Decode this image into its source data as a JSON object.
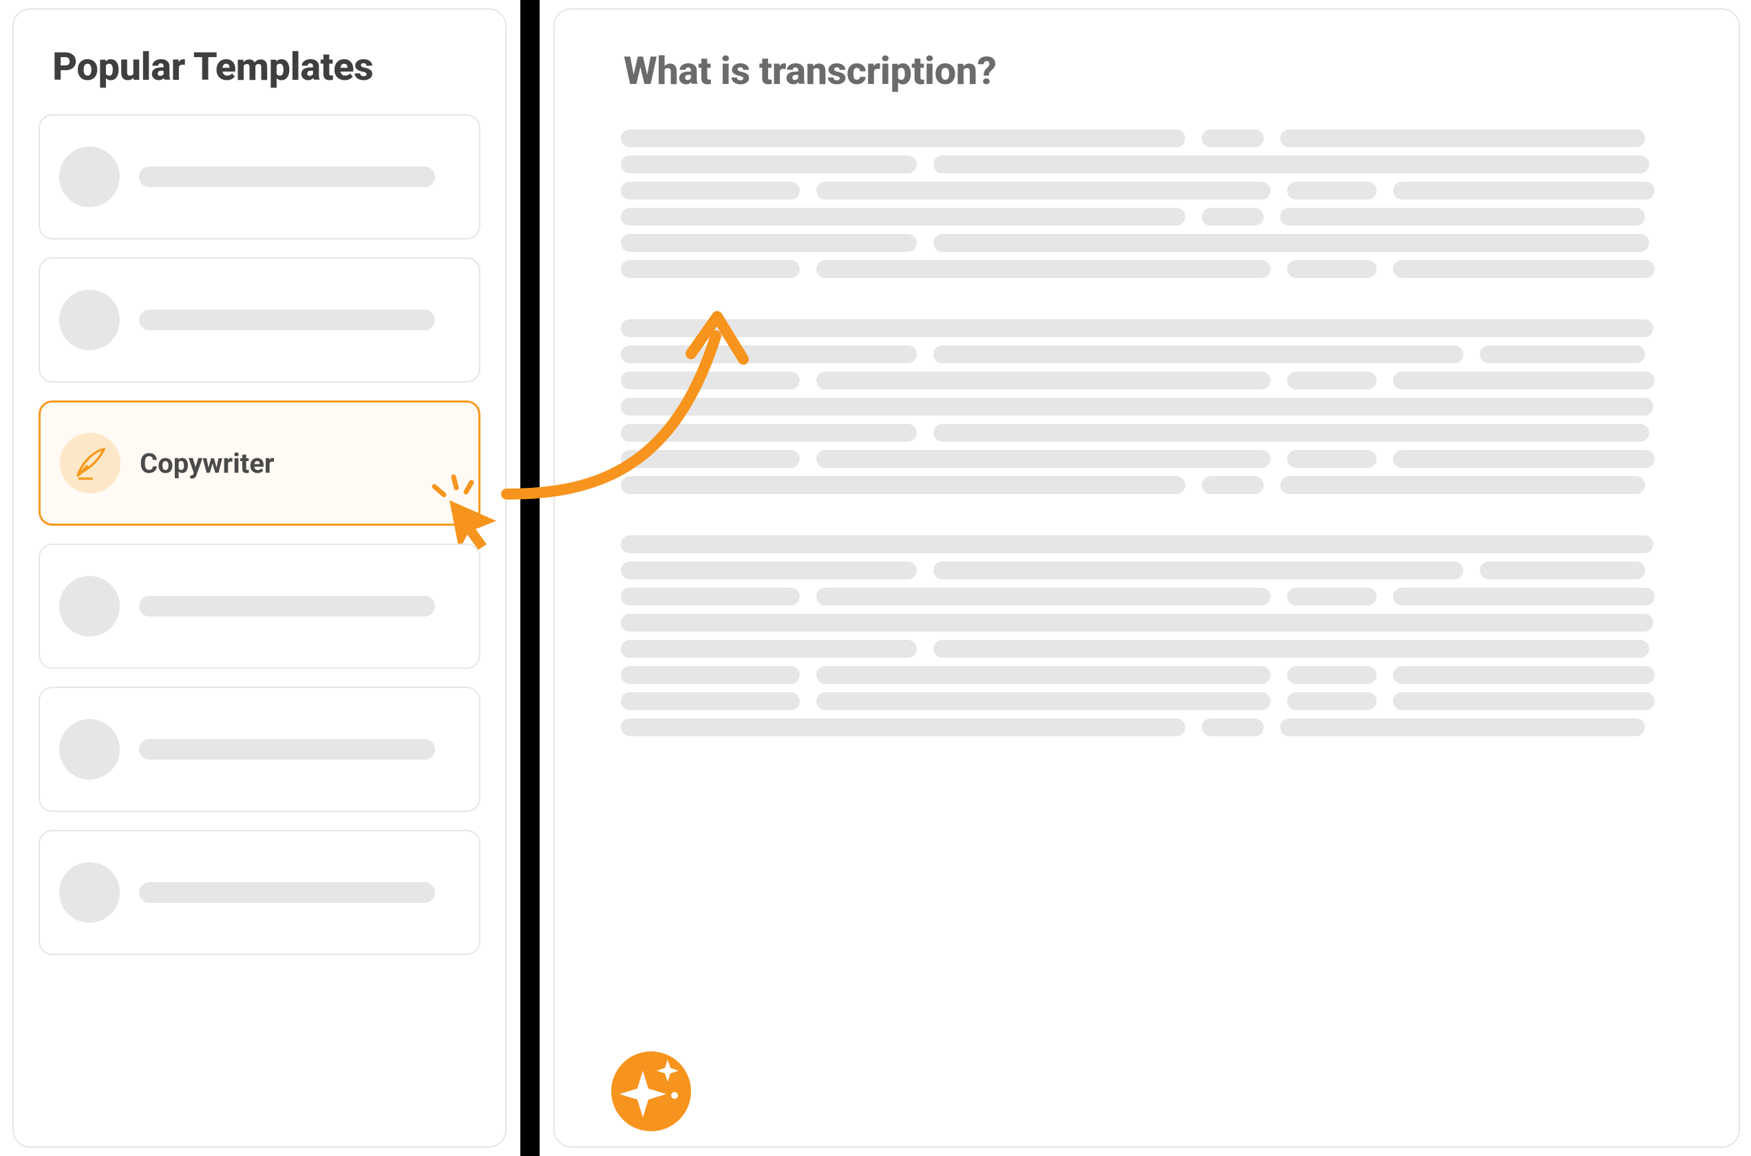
{
  "sidebar": {
    "title": "Popular Templates",
    "items": [
      {
        "label": "",
        "selected": false,
        "icon": "placeholder"
      },
      {
        "label": "",
        "selected": false,
        "icon": "placeholder"
      },
      {
        "label": "Copywriter",
        "selected": true,
        "icon": "quill-icon"
      },
      {
        "label": "",
        "selected": false,
        "icon": "placeholder"
      },
      {
        "label": "",
        "selected": false,
        "icon": "placeholder"
      },
      {
        "label": "",
        "selected": false,
        "icon": "placeholder"
      }
    ]
  },
  "content": {
    "title": "What is transcription?"
  },
  "colors": {
    "accent": "#f79a1e",
    "accent_light": "#fde7c9",
    "placeholder": "#e6e6e6",
    "text_heading": "#3f3f3f",
    "text_subheading": "#6b6b6b"
  }
}
